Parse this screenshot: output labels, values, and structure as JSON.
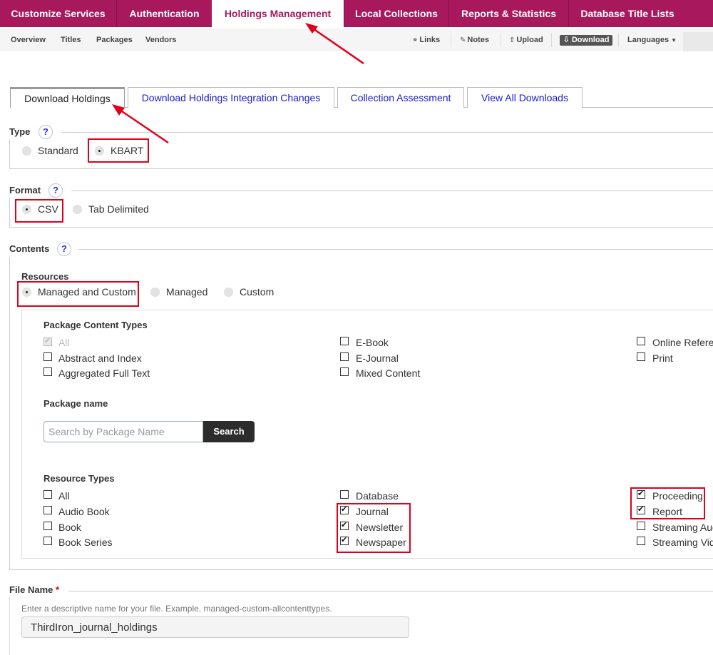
{
  "top_nav": {
    "tabs": [
      {
        "label": "Customize Services"
      },
      {
        "label": "Authentication"
      },
      {
        "label": "Holdings Management",
        "active": true
      },
      {
        "label": "Local Collections"
      },
      {
        "label": "Reports & Statistics"
      },
      {
        "label": "Database Title Lists"
      }
    ]
  },
  "sub_nav": {
    "left": [
      "Overview",
      "Titles",
      "Packages",
      "Vendors"
    ],
    "links": "Links",
    "notes": "Notes",
    "upload": "Upload",
    "download": "Download",
    "languages": "Languages"
  },
  "page_tabs": [
    {
      "label": "Download Holdings",
      "active": true
    },
    {
      "label": "Download Holdings Integration Changes"
    },
    {
      "label": "Collection Assessment"
    },
    {
      "label": "View All Downloads"
    }
  ],
  "type_section": {
    "label": "Type",
    "help": "?",
    "options": [
      {
        "label": "Standard",
        "selected": false
      },
      {
        "label": "KBART",
        "selected": true
      }
    ]
  },
  "format_section": {
    "label": "Format",
    "help": "?",
    "options": [
      {
        "label": "CSV",
        "selected": true
      },
      {
        "label": "Tab Delimited",
        "selected": false
      }
    ]
  },
  "contents_section": {
    "label": "Contents",
    "help": "?",
    "resources_label": "Resources",
    "resources": [
      {
        "label": "Managed and Custom",
        "selected": true
      },
      {
        "label": "Managed",
        "selected": false
      },
      {
        "label": "Custom",
        "selected": false
      }
    ],
    "package_content_types_label": "Package Content Types",
    "package_content_types": [
      {
        "label": "All",
        "checked": true,
        "disabled": true
      },
      {
        "label": "Abstract and Index",
        "checked": false
      },
      {
        "label": "Aggregated Full Text",
        "checked": false
      },
      {
        "label": "E-Book",
        "checked": false
      },
      {
        "label": "E-Journal",
        "checked": false
      },
      {
        "label": "Mixed Content",
        "checked": false
      },
      {
        "label": "Online Reference",
        "checked": false
      },
      {
        "label": "Print",
        "checked": false
      }
    ],
    "package_name_label": "Package name",
    "package_search": {
      "placeholder": "Search by Package Name",
      "button": "Search"
    },
    "resource_types_label": "Resource Types",
    "resource_types": [
      {
        "label": "All",
        "checked": false
      },
      {
        "label": "Audio Book",
        "checked": false
      },
      {
        "label": "Book",
        "checked": false
      },
      {
        "label": "Book Series",
        "checked": false
      },
      {
        "label": "Database",
        "checked": false
      },
      {
        "label": "Journal",
        "checked": true
      },
      {
        "label": "Newsletter",
        "checked": true
      },
      {
        "label": "Newspaper",
        "checked": true
      },
      {
        "label": "Proceeding",
        "checked": true
      },
      {
        "label": "Report",
        "checked": true
      },
      {
        "label": "Streaming Audio",
        "checked": false
      },
      {
        "label": "Streaming Video",
        "checked": false
      }
    ]
  },
  "file_name_section": {
    "label": "File Name",
    "required_mark": "*",
    "hint": "Enter a descriptive name for your file. Example, managed-custom-allcontenttypes.",
    "value": "ThirdIron_journal_holdings"
  },
  "colors": {
    "brand": "#a7195c",
    "annotation": "#e0001b",
    "link": "#1a1ac7"
  }
}
